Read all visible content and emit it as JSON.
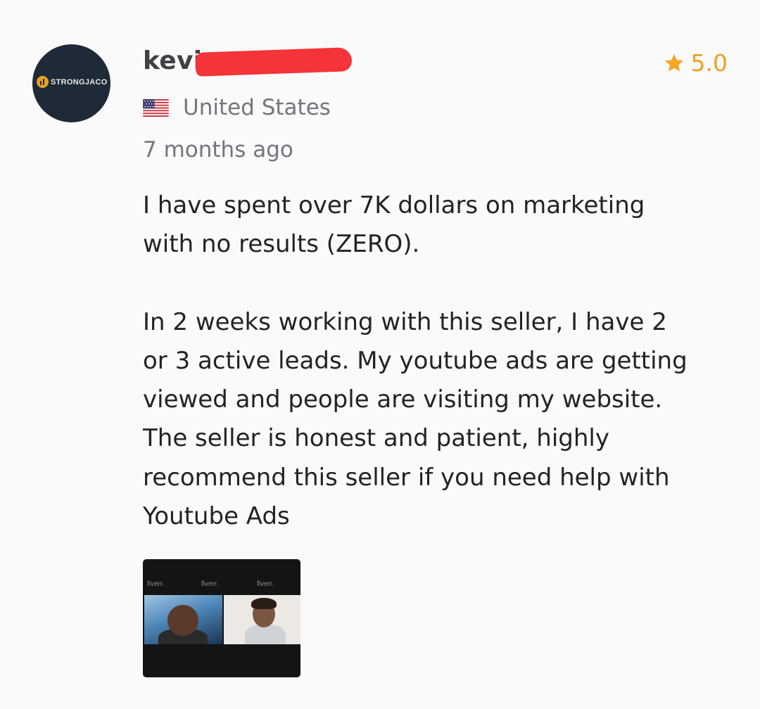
{
  "reviewer": {
    "avatar_text": "STRONGJACO",
    "name_visible": "kevi",
    "country": "United States",
    "country_flag_icon": "us-flag-icon",
    "time_ago": "7 months ago"
  },
  "rating": {
    "icon": "star-icon",
    "value": "5.0",
    "color": "#f5a623"
  },
  "review": {
    "paragraphs": [
      "I have spent over 7K dollars on marketing\nwith no results (ZERO).",
      "In 2 weeks working with this seller, I have 2\nor 3 active leads. My youtube ads are getting\nviewed and people are visiting my website.\nThe seller is honest and patient, highly\nrecommend this seller if you need help with\nYoutube Ads"
    ]
  },
  "attachment": {
    "watermarks": [
      "fiverr.",
      "fiverr.",
      "fiverr."
    ]
  },
  "colors": {
    "background": "#fafafa",
    "redaction": "#f4333a",
    "muted_text": "#74767e"
  }
}
